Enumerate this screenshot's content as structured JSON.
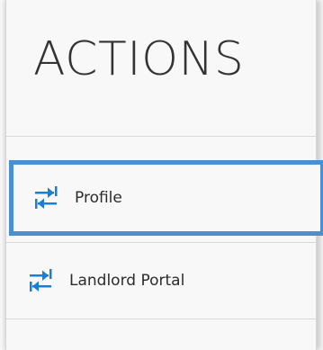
{
  "panel": {
    "heading": "ACTIONS",
    "actions": [
      {
        "label": "Profile",
        "icon": "swap-arrows-icon",
        "focused": true
      },
      {
        "label": "Landlord Portal",
        "icon": "swap-arrows-icon",
        "focused": false
      }
    ]
  },
  "colors": {
    "focus_outline": "#4a8fd1",
    "icon": "#1a7fd4",
    "text": "#2b2b2b",
    "heading": "#333333"
  }
}
